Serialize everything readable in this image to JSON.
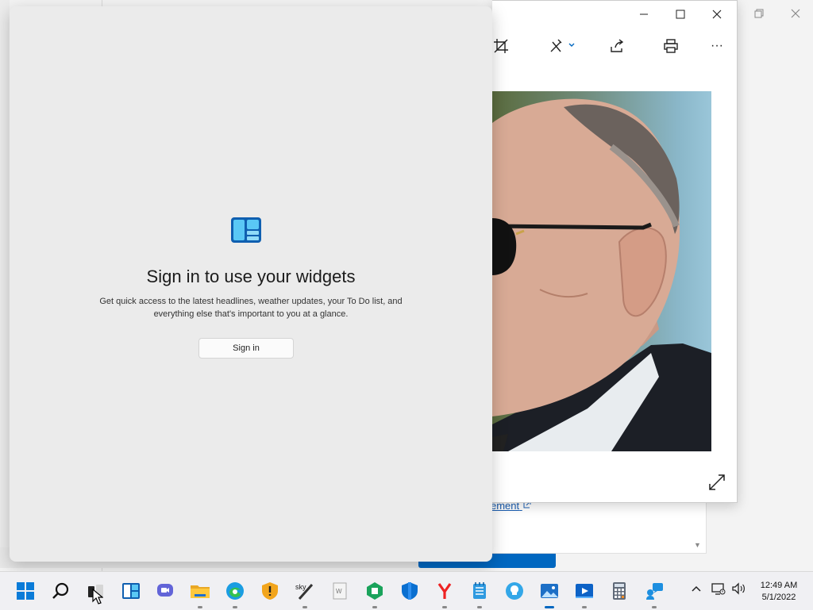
{
  "photos": {
    "title_buttons": {
      "minimize": "minimize",
      "maximize": "maximize",
      "close": "close"
    },
    "toolbar": [
      "crop-icon",
      "draw-icon",
      "share-icon",
      "print-icon",
      "more-icon"
    ],
    "more_label": "···"
  },
  "background": {
    "link_text": "ement",
    "restore_icon": "restore-icon",
    "close_icon": "close-icon"
  },
  "widgets": {
    "title": "Sign in to use your widgets",
    "description": "Get quick access to the latest headlines, weather updates, your To Do list, and everything else that's important to you at a glance.",
    "signin_label": "Sign in"
  },
  "taskbar": {
    "apps": [
      "start",
      "search",
      "task-view",
      "widgets",
      "chat",
      "file-explorer",
      "edge",
      "security-app",
      "pen-app",
      "document-app",
      "hex-app",
      "defender",
      "yandex",
      "notepad",
      "bulb-app",
      "photos",
      "media-app",
      "calculator",
      "feedback"
    ],
    "time": "12:49 AM",
    "date": "5/1/2022"
  },
  "colors": {
    "accent": "#0067c0",
    "widgets_bg": "#ebebeb"
  }
}
